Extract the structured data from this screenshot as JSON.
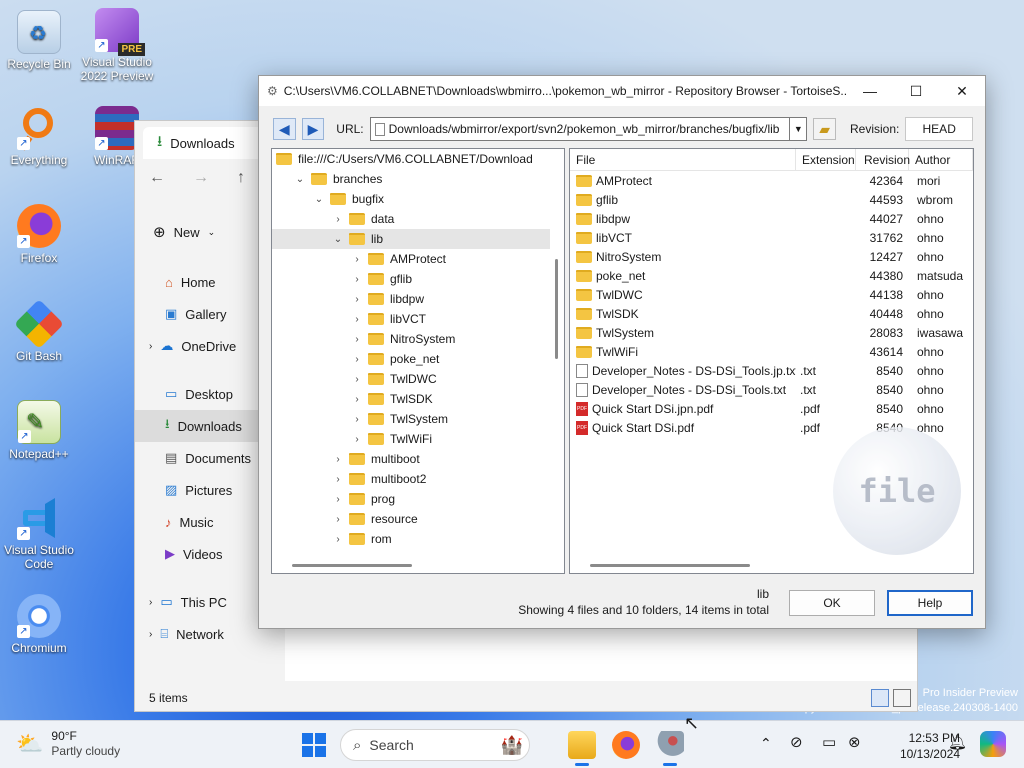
{
  "desktop": {
    "icons": [
      {
        "label": "Recycle Bin",
        "icon": "recycle-bin-icon"
      },
      {
        "label": "Visual Studio 2022 Preview",
        "icon": "visual-studio-icon",
        "badge": "PRE"
      },
      {
        "label": "Everything",
        "icon": "everything-search-icon"
      },
      {
        "label": "WinRAR",
        "icon": "winrar-icon"
      },
      {
        "label": "Firefox",
        "icon": "firefox-icon"
      },
      {
        "label": "Git Bash",
        "icon": "git-bash-icon"
      },
      {
        "label": "Notepad++",
        "icon": "notepadpp-icon"
      },
      {
        "label": "Visual Studio Code",
        "icon": "vscode-icon"
      },
      {
        "label": "Chromium",
        "icon": "chromium-icon"
      }
    ],
    "watermark_line1": "Pro Insider Preview",
    "watermark_line2": "Evaluation copy. Build 26100.rs_prerelease.240308-1400"
  },
  "explorer": {
    "tab_title": "Downloads",
    "new_label": "New",
    "sidebar": [
      "Home",
      "Gallery",
      "OneDrive",
      "Desktop",
      "Downloads",
      "Documents",
      "Pictures",
      "Music",
      "Videos",
      "This PC",
      "Network"
    ],
    "status": "5 items"
  },
  "repo": {
    "title": "C:\\Users\\VM6.COLLABNET\\Downloads\\wbmirro...\\pokemon_wb_mirror - Repository Browser - TortoiseS...",
    "url_label": "URL:",
    "url_value": "Downloads/wbmirror/export/svn2/pokemon_wb_mirror/branches/bugfix/lib",
    "revision_label": "Revision:",
    "revision_value": "HEAD",
    "tree": [
      {
        "label": "file:///C:/Users/VM6.COLLABNET/Download",
        "level": 0,
        "chev": ""
      },
      {
        "label": "branches",
        "level": 1,
        "chev": "v"
      },
      {
        "label": "bugfix",
        "level": 2,
        "chev": "v"
      },
      {
        "label": "data",
        "level": 3,
        "chev": ">"
      },
      {
        "label": "lib",
        "level": 3,
        "chev": "v",
        "selected": true
      },
      {
        "label": "AMProtect",
        "level": 4,
        "chev": ">"
      },
      {
        "label": "gflib",
        "level": 4,
        "chev": ">"
      },
      {
        "label": "libdpw",
        "level": 4,
        "chev": ">"
      },
      {
        "label": "libVCT",
        "level": 4,
        "chev": ">"
      },
      {
        "label": "NitroSystem",
        "level": 4,
        "chev": ">"
      },
      {
        "label": "poke_net",
        "level": 4,
        "chev": ">"
      },
      {
        "label": "TwlDWC",
        "level": 4,
        "chev": ">"
      },
      {
        "label": "TwlSDK",
        "level": 4,
        "chev": ">"
      },
      {
        "label": "TwlSystem",
        "level": 4,
        "chev": ">"
      },
      {
        "label": "TwlWiFi",
        "level": 4,
        "chev": ">"
      },
      {
        "label": "multiboot",
        "level": 3,
        "chev": ">"
      },
      {
        "label": "multiboot2",
        "level": 3,
        "chev": ">"
      },
      {
        "label": "prog",
        "level": 3,
        "chev": ">"
      },
      {
        "label": "resource",
        "level": 3,
        "chev": ">"
      },
      {
        "label": "rom",
        "level": 3,
        "chev": ">"
      }
    ],
    "columns": {
      "file": "File",
      "extension": "Extension",
      "revision": "Revision",
      "author": "Author"
    },
    "files": [
      {
        "name": "AMProtect",
        "ext": "",
        "rev": "42364",
        "author": "mori",
        "type": "folder"
      },
      {
        "name": "gflib",
        "ext": "",
        "rev": "44593",
        "author": "wbrom",
        "type": "folder"
      },
      {
        "name": "libdpw",
        "ext": "",
        "rev": "44027",
        "author": "ohno",
        "type": "folder"
      },
      {
        "name": "libVCT",
        "ext": "",
        "rev": "31762",
        "author": "ohno",
        "type": "folder"
      },
      {
        "name": "NitroSystem",
        "ext": "",
        "rev": "12427",
        "author": "ohno",
        "type": "folder"
      },
      {
        "name": "poke_net",
        "ext": "",
        "rev": "44380",
        "author": "matsuda",
        "type": "folder"
      },
      {
        "name": "TwlDWC",
        "ext": "",
        "rev": "44138",
        "author": "ohno",
        "type": "folder"
      },
      {
        "name": "TwlSDK",
        "ext": "",
        "rev": "40448",
        "author": "ohno",
        "type": "folder"
      },
      {
        "name": "TwlSystem",
        "ext": "",
        "rev": "28083",
        "author": "iwasawa",
        "type": "folder"
      },
      {
        "name": "TwlWiFi",
        "ext": "",
        "rev": "43614",
        "author": "ohno",
        "type": "folder"
      },
      {
        "name": "Developer_Notes - DS-DSi_Tools.jp.txt",
        "ext": ".txt",
        "rev": "8540",
        "author": "ohno",
        "type": "txt"
      },
      {
        "name": "Developer_Notes - DS-DSi_Tools.txt",
        "ext": ".txt",
        "rev": "8540",
        "author": "ohno",
        "type": "txt"
      },
      {
        "name": "Quick Start DSi.jpn.pdf",
        "ext": ".pdf",
        "rev": "8540",
        "author": "ohno",
        "type": "pdf"
      },
      {
        "name": "Quick Start DSi.pdf",
        "ext": ".pdf",
        "rev": "8540",
        "author": "ohno",
        "type": "pdf"
      }
    ],
    "watermark_text": "file",
    "status_path": "lib",
    "status_summary": "Showing 4 files and 10 folders, 14 items in total",
    "ok_label": "OK",
    "help_label": "Help"
  },
  "taskbar": {
    "temp": "90°F",
    "weather": "Partly cloudy",
    "search_placeholder": "Search",
    "time": "12:53 PM",
    "date": "10/13/2024"
  }
}
